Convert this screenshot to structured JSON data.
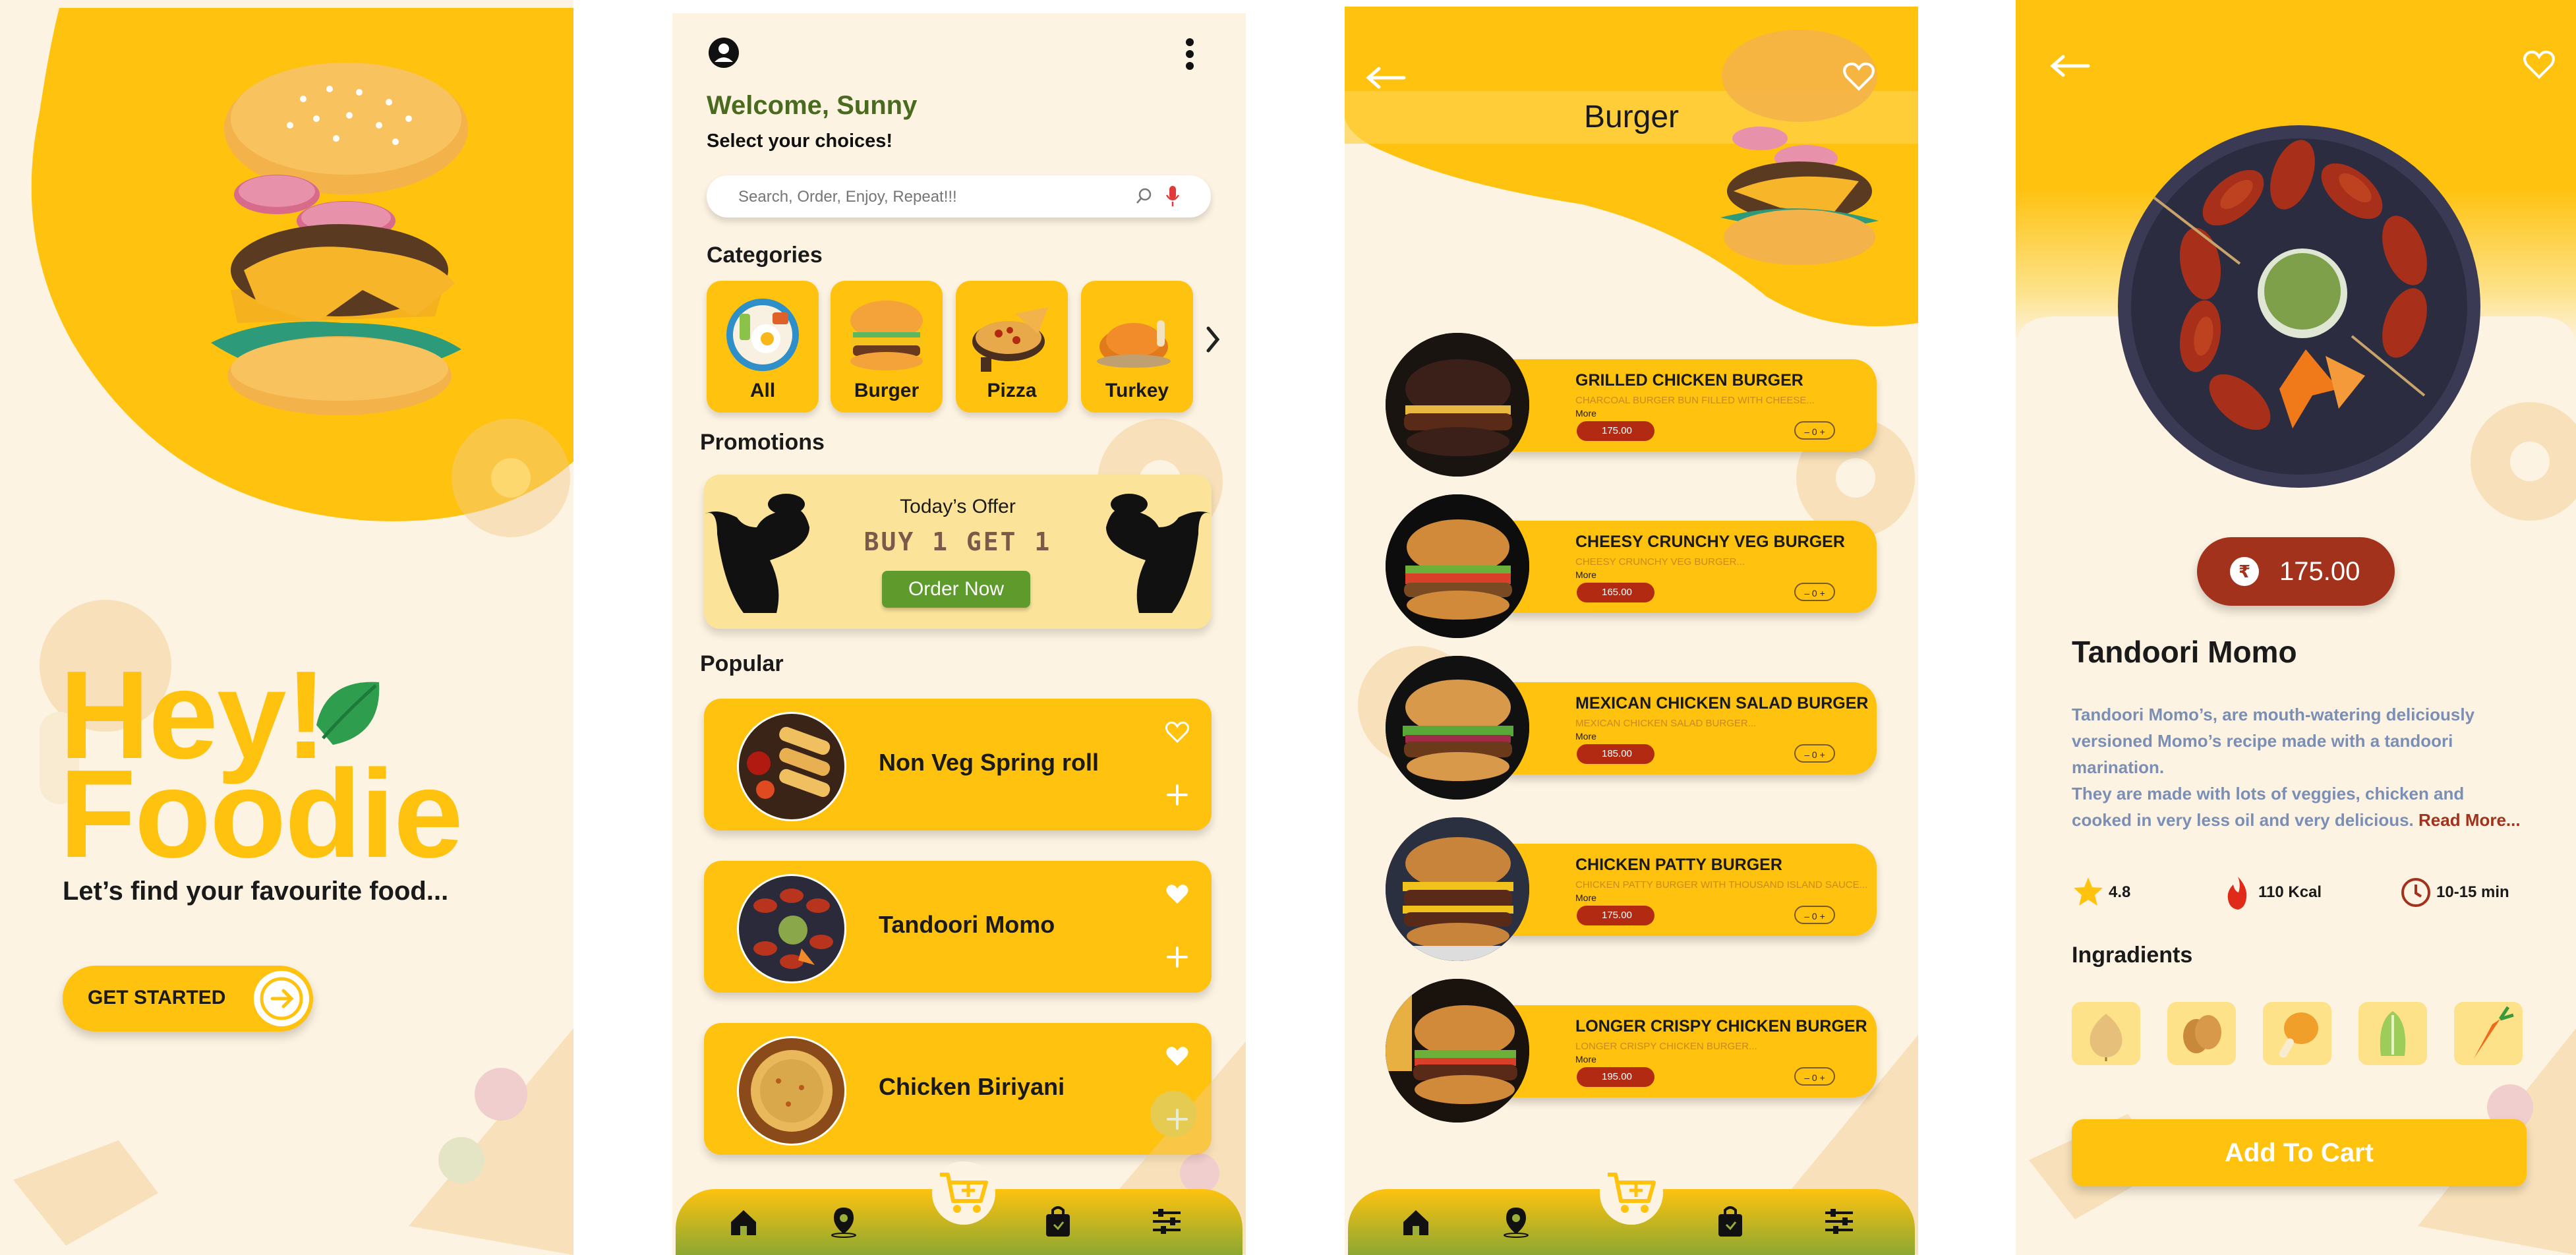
{
  "colors": {
    "accent": "#fec20f",
    "cream": "#fdf3e2",
    "green": "#5e9a2c",
    "brown": "#a2321c",
    "headline_green": "#4a6b1f"
  },
  "splash": {
    "headline_line1": "Hey!",
    "headline_line2": "Foodie",
    "tagline": "Let’s find your favourite food...",
    "cta_label": "GET STARTED"
  },
  "home": {
    "welcome": "Welcome, Sunny",
    "subtitle": "Select your choices!",
    "search_placeholder": "Search, Order, Enjoy, Repeat!!!",
    "categories_title": "Categories",
    "categories": [
      {
        "label": "All",
        "icon": "plate-icon"
      },
      {
        "label": "Burger",
        "icon": "burger-icon"
      },
      {
        "label": "Pizza",
        "icon": "pizza-icon"
      },
      {
        "label": "Turkey",
        "icon": "turkey-icon"
      }
    ],
    "promotions_title": "Promotions",
    "promo": {
      "line1": "Today’s Offer",
      "line2": "BUY 1 GET 1",
      "button": "Order Now"
    },
    "popular_title": "Popular",
    "popular": [
      {
        "name": "Non Veg Spring roll",
        "favorite": false
      },
      {
        "name": "Tandoori Momo",
        "favorite": true
      },
      {
        "name": "Chicken Biriyani",
        "favorite": true
      }
    ],
    "nav": [
      "home-icon",
      "location-icon",
      "cart-icon",
      "bag-icon",
      "filter-icon"
    ]
  },
  "listing": {
    "title": "Burger",
    "items": [
      {
        "name": "GRILLED CHICKEN BURGER",
        "desc": "CHARCOAL BURGER BUN FILLED WITH CHEESE...",
        "more": "More",
        "price": "175.00",
        "qty": "– 0 +"
      },
      {
        "name": "CHEESY CRUNCHY VEG BURGER",
        "desc": "CHEESY CRUNCHY VEG BURGER...",
        "more": "More",
        "price": "165.00",
        "qty": "– 0 +"
      },
      {
        "name": "MEXICAN CHICKEN SALAD BURGER",
        "desc": "MEXICAN CHICKEN SALAD BURGER...",
        "more": "More",
        "price": "185.00",
        "qty": "– 0 +"
      },
      {
        "name": "CHICKEN PATTY BURGER",
        "desc": "CHICKEN PATTY BURGER WITH THOUSAND ISLAND SAUCE...",
        "more": "More",
        "price": "175.00",
        "qty": "– 0 +"
      },
      {
        "name": "LONGER CRISPY CHICKEN BURGER",
        "desc": "LONGER CRISPY CHICKEN BURGER...",
        "more": "More",
        "price": "195.00",
        "qty": "– 0 +"
      }
    ]
  },
  "detail": {
    "price": "175.00",
    "currency_symbol": "₹",
    "title": "Tandoori Momo",
    "desc1": "Tandoori Momo’s, are mouth-watering deliciously versioned Momo’s recipe made with a tandoori marination.",
    "desc2": "They are made with lots of veggies, chicken and cooked in very less oil and very delicious.",
    "read_more": "Read More...",
    "rating": "4.8",
    "calories": "110 Kcal",
    "time": "10-15 min",
    "ingredients_title": "Ingradients",
    "ingredients": [
      "onion-icon",
      "potato-icon",
      "chicken-leg-icon",
      "lettuce-icon",
      "carrot-icon"
    ],
    "add_to_cart": "Add To Cart"
  }
}
